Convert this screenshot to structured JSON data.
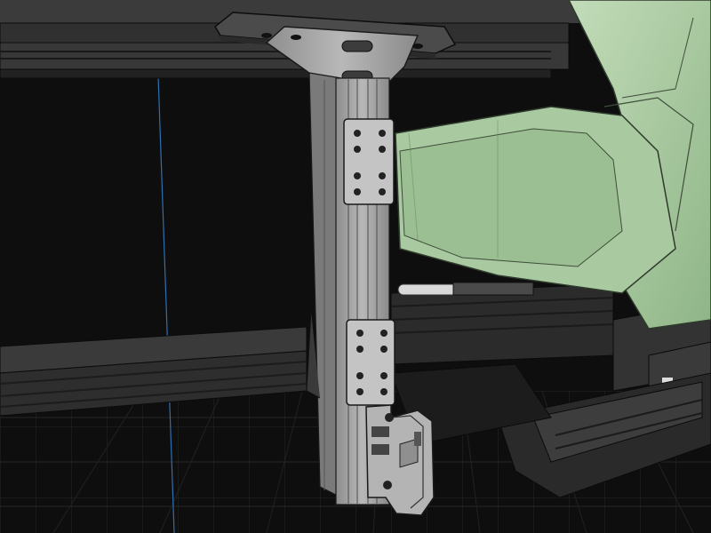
{
  "viewport": {
    "background_color": "#0e0e0e",
    "grid_color": "#2a2a2a",
    "axis_line_color": "#2f6fb0"
  },
  "model": {
    "frame_color": "#4a4a4a",
    "frame_edge_color": "#0b0b0b",
    "bracket_color": "#a9a9a9",
    "bracket_edge_color": "#1a1a1a",
    "seat_color": "#a9c9a0",
    "seat_shadow_color": "#7ea677"
  }
}
